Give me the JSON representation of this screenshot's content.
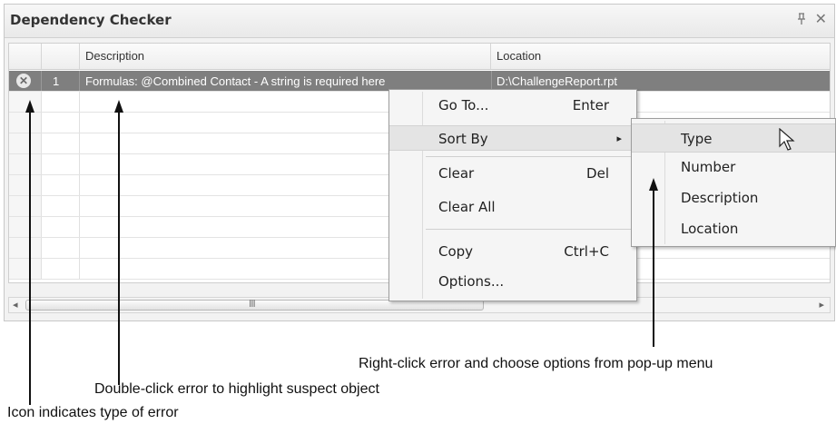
{
  "panel": {
    "title": "Dependency Checker",
    "pin_icon": "p",
    "close_icon": "✕"
  },
  "grid": {
    "columns": [
      "",
      "",
      "Description",
      "Location"
    ],
    "selected_row": {
      "number": "1",
      "description": "Formulas: @Combined Contact - A string is required here",
      "location": "D:\\ChallengeReport.rpt",
      "icon": "error-circle-x"
    }
  },
  "scrollbar": {
    "left_arrow": "◂",
    "right_arrow": "▸",
    "grip": "III"
  },
  "context_menu": {
    "items": [
      {
        "label": "Go To...",
        "shortcut": "Enter"
      },
      {
        "label": "Sort By",
        "shortcut": "▸"
      },
      {
        "label": "Clear",
        "shortcut": "Del"
      },
      {
        "label": "Clear All",
        "shortcut": ""
      },
      {
        "label": "Copy",
        "shortcut": "Ctrl+C"
      },
      {
        "label": "Options...",
        "shortcut": ""
      }
    ]
  },
  "submenu": {
    "items": [
      "Type",
      "Number",
      "Description",
      "Location"
    ]
  },
  "callouts": {
    "right_click": "Right-click error and choose options from pop-up menu",
    "double_click": "Double-click error to highlight suspect object",
    "icon": "Icon indicates type of error"
  }
}
